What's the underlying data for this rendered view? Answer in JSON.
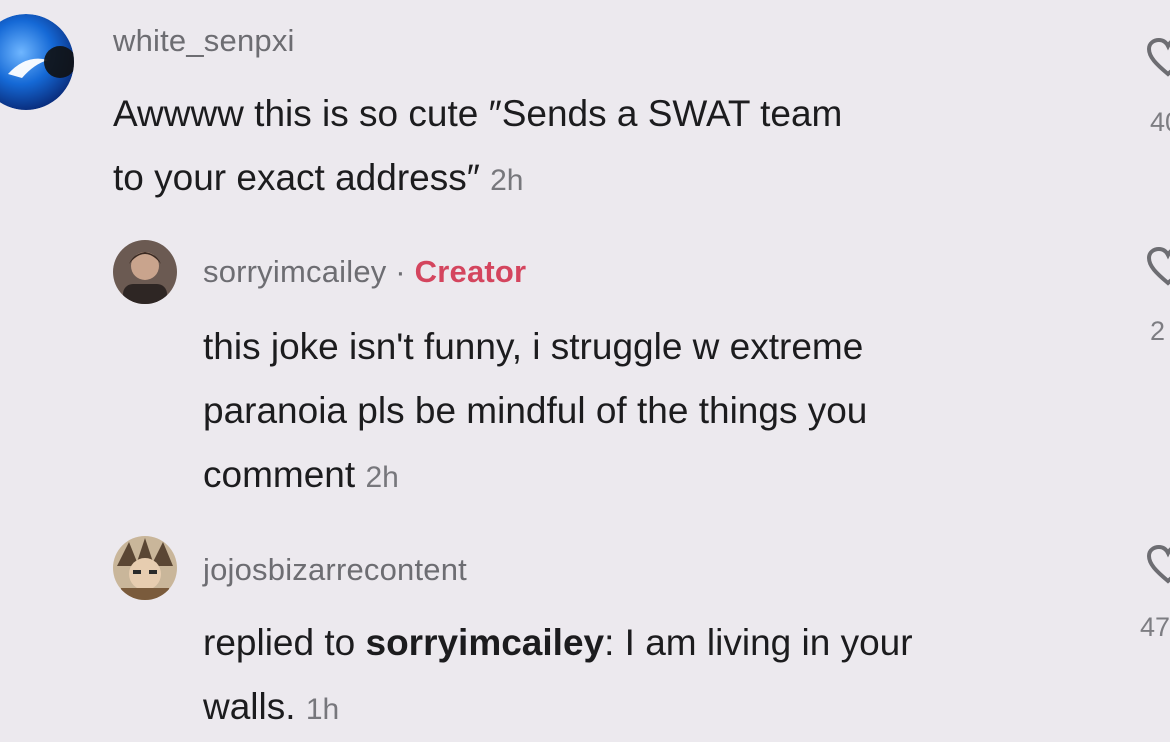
{
  "comments": [
    {
      "username": "white_senpxi",
      "text_line1": "Awwww this is so cute ″Sends a SWAT team",
      "text_line2": "to your exact address″",
      "time": "2h",
      "likes": "40"
    },
    {
      "username": "sorryimcailey",
      "separator": "·",
      "badge": "Creator",
      "text_line1": "this joke isn't funny, i struggle w extreme",
      "text_line2": "paranoia pls be mindful of the things you",
      "text_line3": "comment",
      "time": "2h",
      "likes": "2"
    },
    {
      "username": "jojosbizarrecontent",
      "reply_prefix": "replied to ",
      "reply_target": "sorryimcailey",
      "text_line1_rest": ": I am living in your",
      "text_line2": "walls.",
      "time": "1h",
      "likes": "47"
    }
  ],
  "icons": {
    "avatar_1": "blue-orb-avatar",
    "avatar_2": "photo-avatar",
    "avatar_3": "anime-avatar",
    "like": "heart-outline-icon"
  },
  "colors": {
    "background": "#ece9ee",
    "creator_badge": "#d4455e",
    "username": "#6d6d72",
    "text": "#1c1c1e"
  }
}
